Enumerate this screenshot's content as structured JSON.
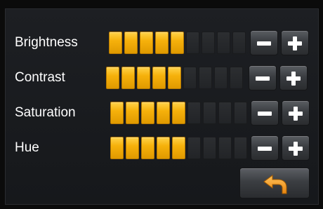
{
  "settings": [
    {
      "label": "Brightness",
      "level": 5,
      "max": 9
    },
    {
      "label": "Contrast",
      "level": 5,
      "max": 9
    },
    {
      "label": "Saturation",
      "level": 5,
      "max": 9
    },
    {
      "label": "Hue",
      "level": 5,
      "max": 9
    }
  ],
  "icons": {
    "decrease": "minus-icon",
    "increase": "plus-icon",
    "back": "undo-arrow-icon"
  },
  "colors": {
    "active_segment": "#f6b10b",
    "inactive_segment": "#2a2c2f",
    "back_arrow": "#f5a623"
  }
}
